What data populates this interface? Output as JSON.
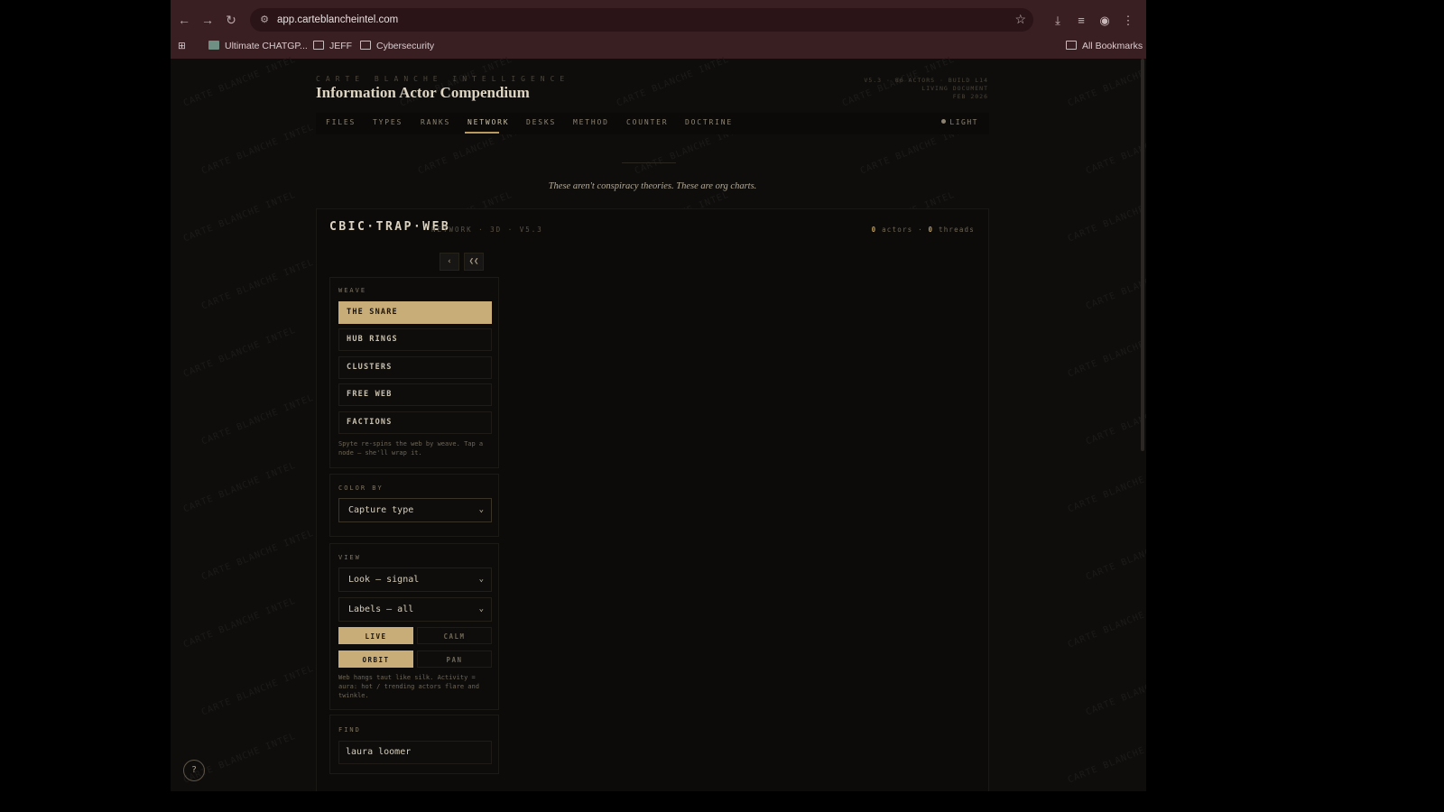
{
  "browser": {
    "url": "app.carteblancheintel.com",
    "bookmarks": [
      {
        "label": "Ultimate CHATGP..."
      },
      {
        "label": "JEFF"
      },
      {
        "label": "Cybersecurity"
      }
    ],
    "all_bookmarks": "All Bookmarks"
  },
  "header": {
    "eyebrow": "CARTE BLANCHE INTELLIGENCE",
    "title": "Information Actor Compendium",
    "meta_line1": "V5.3 · 86 ACTORS · BUILD L14",
    "meta_line2": "LIVING DOCUMENT",
    "meta_line3": "FEB 2026"
  },
  "nav": {
    "tabs": [
      "FILES",
      "TYPES",
      "RANKS",
      "NETWORK",
      "DESKS",
      "METHOD",
      "COUNTER",
      "DOCTRINE"
    ],
    "active": "NETWORK",
    "theme_toggle": "LIGHT"
  },
  "tagline": "These aren't conspiracy theories. These are org charts.",
  "panel": {
    "title": "CBIC·TRAP·WEB",
    "subtitle": "NETWORK · 3D · V5.3",
    "actors_count": "0",
    "actors_label": "actors",
    "threads_count": "0",
    "threads_label": "threads",
    "controls": {
      "collapse": "‹",
      "collapse_all": "❮❮"
    }
  },
  "weave": {
    "label": "WEAVE",
    "options": [
      "THE SNARE",
      "HUB RINGS",
      "CLUSTERS",
      "FREE WEB",
      "FACTIONS"
    ],
    "selected": "THE SNARE",
    "hint": "Spyte re-spins the web by weave. Tap a node — she'll wrap it."
  },
  "color_by": {
    "label": "COLOR BY",
    "value": "Capture type"
  },
  "view": {
    "label": "VIEW",
    "look": "Look — signal",
    "labels": "Labels — all",
    "toggle1": {
      "on": "LIVE",
      "off": "CALM"
    },
    "toggle2": {
      "on": "ORBIT",
      "off": "PAN"
    },
    "hint": "Web hangs taut like silk. Activity = aura: hot / trending actors flare and twinkle."
  },
  "find": {
    "label": "FIND",
    "value": "laura loomer"
  },
  "help": "?",
  "watermark": "CARTE BLANCHE INTEL"
}
